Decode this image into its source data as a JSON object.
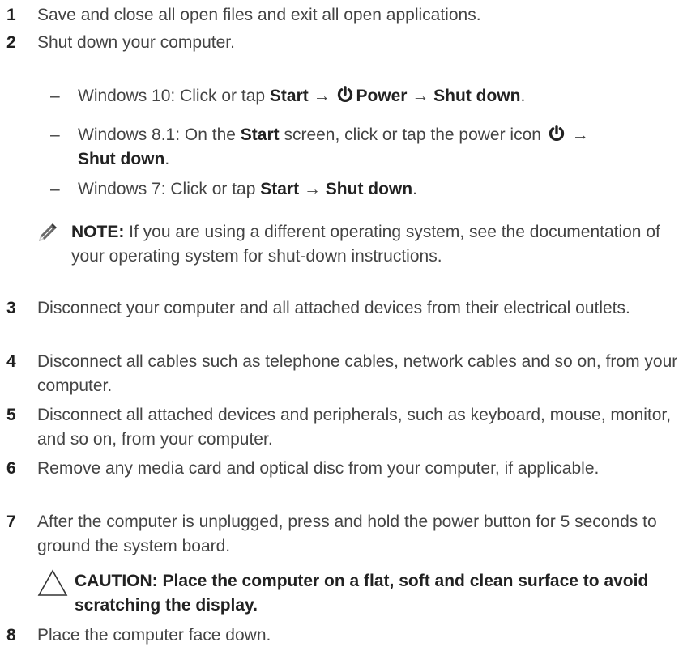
{
  "steps": [
    {
      "num": "1",
      "text": "Save and close all open files and exit all open applications."
    },
    {
      "num": "2",
      "text": "Shut down your computer."
    },
    {
      "num": "3",
      "text": "Disconnect your computer and all attached devices from their electrical outlets."
    },
    {
      "num": "4",
      "text": "Disconnect all cables such as telephone cables, network cables and so on, from your computer."
    },
    {
      "num": "5",
      "text": "Disconnect all attached devices and peripherals, such as keyboard, mouse, monitor, and so on, from your computer."
    },
    {
      "num": "6",
      "text": "Remove any media card and optical disc from your computer, if applicable."
    },
    {
      "num": "7",
      "text": "After the computer is unplugged, press and hold the power button for 5 seconds to ground the system board."
    },
    {
      "num": "8",
      "text": "Place the computer face down."
    }
  ],
  "substeps": {
    "dash": "–",
    "win10": {
      "prefix": "Windows 10: Click or tap ",
      "start": "Start",
      "arrow1": " → ",
      "power": "Power",
      "arrow2": " → ",
      "shutdown": "Shut down",
      "end": "."
    },
    "win81": {
      "prefix": "Windows 8.1: On the ",
      "start": "Start",
      "middle": " screen, click or tap the power icon ",
      "arrow": " →",
      "shutdown": "Shut down",
      "end": "."
    },
    "win7": {
      "prefix": "Windows 7: Click or tap ",
      "start": "Start",
      "arrow": " → ",
      "shutdown": "Shut down",
      "end": "."
    }
  },
  "note": {
    "label": "NOTE:",
    "text": " If you are using a different operating system, see the documentation of your operating system for shut-down instructions."
  },
  "caution": {
    "text": "CAUTION: Place the computer on a flat, soft and clean surface to avoid scratching the display."
  },
  "icons": {
    "power": "power-icon",
    "note": "pencil-note-icon",
    "caution": "warning-triangle-icon"
  }
}
